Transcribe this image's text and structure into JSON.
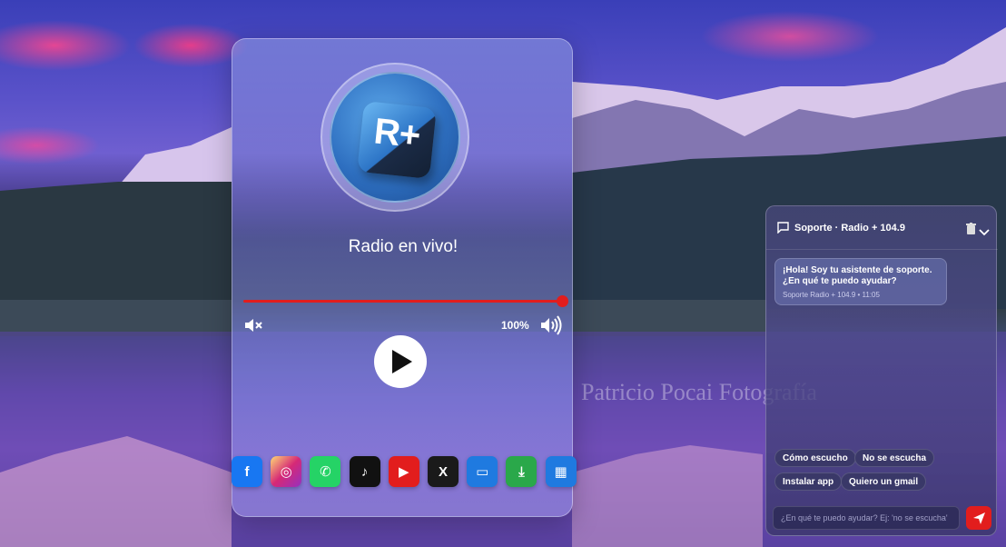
{
  "player": {
    "title": "Radio en vivo!",
    "logo_text": "R+",
    "volume_text": "100%",
    "progress_percent": 100,
    "socials": [
      {
        "name": "facebook",
        "glyph": "f",
        "color": "#1877f2"
      },
      {
        "name": "instagram",
        "glyph": "◎",
        "color": "#d62976"
      },
      {
        "name": "whatsapp",
        "glyph": "✆",
        "color": "#25d366"
      },
      {
        "name": "tiktok",
        "glyph": "♪",
        "color": "#111111"
      },
      {
        "name": "youtube",
        "glyph": "▶",
        "color": "#e21d1d"
      },
      {
        "name": "x",
        "glyph": "X",
        "color": "#1a1a1a"
      },
      {
        "name": "tv",
        "glyph": "▭",
        "color": "#1f7ae0"
      },
      {
        "name": "download",
        "glyph": "⤓",
        "color": "#2aa84a"
      },
      {
        "name": "film",
        "glyph": "▦",
        "color": "#1f7ae0"
      }
    ]
  },
  "chat": {
    "title": "Soporte · Radio + 104.9",
    "message": "¡Hola! Soy tu asistente de soporte. ¿En qué te puedo ayudar?",
    "message_meta": "Soporte Radio + 104.9 • 11:05",
    "chips": [
      "Cómo escucho",
      "No se escucha",
      "Instalar app",
      "Quiero un gmail"
    ],
    "input_placeholder": "¿En qué te puedo ayudar? Ej: 'no se escucha'"
  },
  "background_watermark": "Patricio Pocai Fotografía"
}
